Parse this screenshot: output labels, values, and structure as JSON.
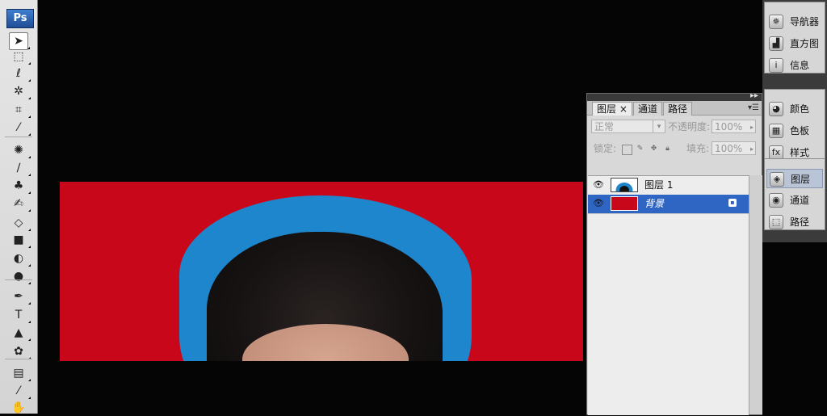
{
  "toolbox": {
    "logo": "Ps",
    "tools": [
      {
        "name": "move-tool",
        "glyph": "➤"
      },
      {
        "name": "marquee-tool",
        "glyph": "⬚"
      },
      {
        "name": "lasso-tool",
        "glyph": "ℓ"
      },
      {
        "name": "magic-wand-tool",
        "glyph": "✲"
      },
      {
        "name": "crop-tool",
        "glyph": "⌗"
      },
      {
        "name": "eyedropper-tool",
        "glyph": "⁄"
      },
      {
        "name": "healing-brush-tool",
        "glyph": "✺"
      },
      {
        "name": "brush-tool",
        "glyph": "∕"
      },
      {
        "name": "clone-stamp-tool",
        "glyph": "♣"
      },
      {
        "name": "history-brush-tool",
        "glyph": "✍"
      },
      {
        "name": "eraser-tool",
        "glyph": "◇"
      },
      {
        "name": "gradient-tool",
        "glyph": "■"
      },
      {
        "name": "blur-tool",
        "glyph": "◐"
      },
      {
        "name": "dodge-tool",
        "glyph": "●"
      },
      {
        "name": "pen-tool",
        "glyph": "✒"
      },
      {
        "name": "type-tool",
        "glyph": "T"
      },
      {
        "name": "path-selection-tool",
        "glyph": "▲"
      },
      {
        "name": "custom-shape-tool",
        "glyph": "✿"
      },
      {
        "name": "notes-tool",
        "glyph": "▤"
      },
      {
        "name": "eyedropper-sample-tool",
        "glyph": "⁄"
      },
      {
        "name": "hand-tool",
        "glyph": "✋"
      }
    ]
  },
  "layers_panel": {
    "tabs": [
      "图层 ×",
      "通道",
      "路径"
    ],
    "blend_mode": "正常",
    "opacity_label": "不透明度:",
    "opacity_value": "100%",
    "lock_label": "锁定:",
    "fill_label": "填充:",
    "fill_value": "100%",
    "layers": [
      {
        "name": "图层 1",
        "selected": false
      },
      {
        "name": "背景",
        "selected": true
      }
    ]
  },
  "dock": {
    "groups": [
      [
        {
          "label": "导航器",
          "icon": "navigator-icon",
          "glyph": "✵"
        },
        {
          "label": "直方图",
          "icon": "histogram-icon",
          "glyph": "▟"
        },
        {
          "label": "信息",
          "icon": "info-icon",
          "glyph": "i"
        }
      ],
      [
        {
          "label": "颜色",
          "icon": "color-icon",
          "glyph": "◕"
        },
        {
          "label": "色板",
          "icon": "swatches-icon",
          "glyph": "▦"
        },
        {
          "label": "样式",
          "icon": "styles-icon",
          "glyph": "fx"
        }
      ],
      [
        {
          "label": "图层",
          "icon": "layers-icon",
          "glyph": "◈"
        },
        {
          "label": "通道",
          "icon": "channels-icon",
          "glyph": "◉"
        },
        {
          "label": "路径",
          "icon": "paths-icon",
          "glyph": "⬚"
        }
      ]
    ]
  },
  "colors": {
    "canvas_red": "#c8081a",
    "photo_blue": "#1d86cc",
    "selection_blue": "#2f66c4"
  }
}
